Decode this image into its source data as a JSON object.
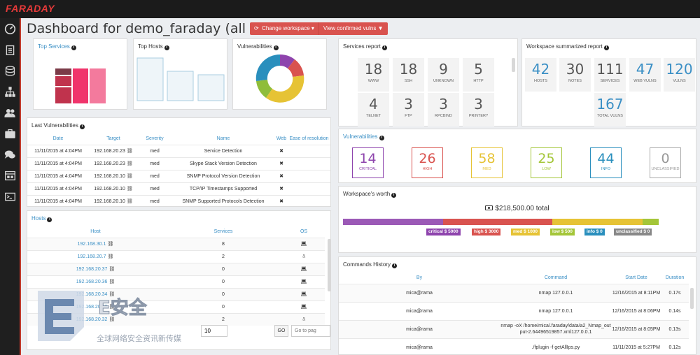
{
  "app": {
    "logo": "FARADAY"
  },
  "header": {
    "title": "Dashboard for demo_faraday (all vulns)",
    "change_workspace": "Change workspace",
    "view_confirmed": "View confirmed vulns"
  },
  "panels": {
    "top_services": "Top Services",
    "top_hosts": "Top Hosts",
    "vulnerabilities_chart": "Vulnerabilities",
    "services_report": "Services report",
    "workspace_summary": "Workspace summarized report",
    "vulnerabilities": "Vulnerabilities",
    "workspace_worth": "Workspace's worth",
    "last_vulns": "Last Vulnerabilities",
    "hosts": "Hosts",
    "commands_history": "Commands History"
  },
  "services_report": [
    {
      "num": "18",
      "label": "WWW"
    },
    {
      "num": "18",
      "label": "SSH"
    },
    {
      "num": "9",
      "label": "UNKNOWN"
    },
    {
      "num": "5",
      "label": "HTTP"
    },
    {
      "num": "4",
      "label": "TELNET"
    },
    {
      "num": "3",
      "label": "FTP"
    },
    {
      "num": "3",
      "label": "RPCBIND"
    },
    {
      "num": "3",
      "label": "PRINTER?"
    }
  ],
  "workspace_summary": [
    {
      "num": "42",
      "label": "HOSTS"
    },
    {
      "num": "30",
      "label": "NOTES"
    },
    {
      "num": "111",
      "label": "SERVICES"
    },
    {
      "num": "47",
      "label": "WEB VULNS"
    },
    {
      "num": "120",
      "label": "VULNS"
    },
    {
      "num": "167",
      "label": "TOTAL VULNS"
    }
  ],
  "vuln_counts": [
    {
      "num": "14",
      "label": "CRITICAL",
      "color": "#8e44ad"
    },
    {
      "num": "26",
      "label": "HIGH",
      "color": "#d9534f"
    },
    {
      "num": "58",
      "label": "MED",
      "color": "#e6c335"
    },
    {
      "num": "25",
      "label": "LOW",
      "color": "#a4c639"
    },
    {
      "num": "44",
      "label": "INFO",
      "color": "#2a8fbd"
    },
    {
      "num": "0",
      "label": "UNCLASSIFIED",
      "color": "#999999"
    }
  ],
  "worth": {
    "total": "$218,500.00 total",
    "segments": [
      {
        "label": "critical $ 5000",
        "color": "#9b59b6",
        "share": 0.31
      },
      {
        "label": "high $ 3000",
        "color": "#d9534f",
        "share": 0.34
      },
      {
        "label": "med $ 1000",
        "color": "#e6c335",
        "share": 0.28
      },
      {
        "label": "low $ 500",
        "color": "#a4c639",
        "share": 0.05
      },
      {
        "label": "info $ 0",
        "color": "#2a8fbd",
        "share": 0.0
      },
      {
        "label": "unclassified $ 0",
        "color": "#888888",
        "share": 0.0
      }
    ]
  },
  "last_vulns": {
    "columns": [
      "Date",
      "Target",
      "Severity",
      "Name",
      "Web",
      "Ease of resolution"
    ],
    "rows": [
      {
        "date": "11/11/2015 at 4:04PM",
        "target": "192.168.20.23",
        "severity": "med",
        "name": "Service Detection",
        "web": "✖"
      },
      {
        "date": "11/11/2015 at 4:04PM",
        "target": "192.168.20.23",
        "severity": "med",
        "name": "Skype Stack Version Detection",
        "web": "✖"
      },
      {
        "date": "11/11/2015 at 4:04PM",
        "target": "192.168.20.10",
        "severity": "med",
        "name": "SNMP Protocol Version Detection",
        "web": "✖"
      },
      {
        "date": "11/11/2015 at 4:04PM",
        "target": "192.168.20.10",
        "severity": "med",
        "name": "TCP/IP Timestamps Supported",
        "web": "✖"
      },
      {
        "date": "11/11/2015 at 4:04PM",
        "target": "192.168.20.10",
        "severity": "med",
        "name": "SNMP Supported Protocols Detection",
        "web": "✖"
      }
    ]
  },
  "hosts": {
    "columns": [
      "Host",
      "Services",
      "OS"
    ],
    "rows": [
      {
        "host": "192.168.30.1",
        "services": "8",
        "os": "laptop"
      },
      {
        "host": "192.168.20.7",
        "services": "2",
        "os": "linux"
      },
      {
        "host": "192.168.20.37",
        "services": "0",
        "os": "laptop"
      },
      {
        "host": "192.168.20.36",
        "services": "0",
        "os": "laptop"
      },
      {
        "host": "192.168.20.34",
        "services": "0",
        "os": "laptop"
      },
      {
        "host": "192.168.20.33",
        "services": "0",
        "os": "laptop"
      },
      {
        "host": "192.168.20.32",
        "services": "2",
        "os": "linux"
      }
    ],
    "page_size": "10",
    "go": "GO",
    "go_placeholder": "Go to pag"
  },
  "commands": {
    "columns": [
      "By",
      "Command",
      "Start Date",
      "Duration"
    ],
    "rows": [
      {
        "by": "mica@rama",
        "command": "nmap 127.0.0.1",
        "date": "12/16/2015 at 8:11PM",
        "duration": "0.17s"
      },
      {
        "by": "mica@rama",
        "command": "nmap 127.0.0.1",
        "date": "12/16/2015 at 8:06PM",
        "duration": "0.14s"
      },
      {
        "by": "mica@rama",
        "command": "nmap -oX /home/mica/.faraday/data/a2_Nmap_output-2.64496519857.xml127.0.0.1",
        "date": "12/16/2015 at 8:05PM",
        "duration": "0.13s"
      },
      {
        "by": "mica@rama",
        "command": "./fplugin -f getAllIps.py",
        "date": "11/11/2015 at 5:27PM",
        "duration": "0.12s"
      }
    ]
  },
  "watermark": {
    "title": "E安全",
    "subtitle": "全球网络安全资讯新传媒"
  }
}
